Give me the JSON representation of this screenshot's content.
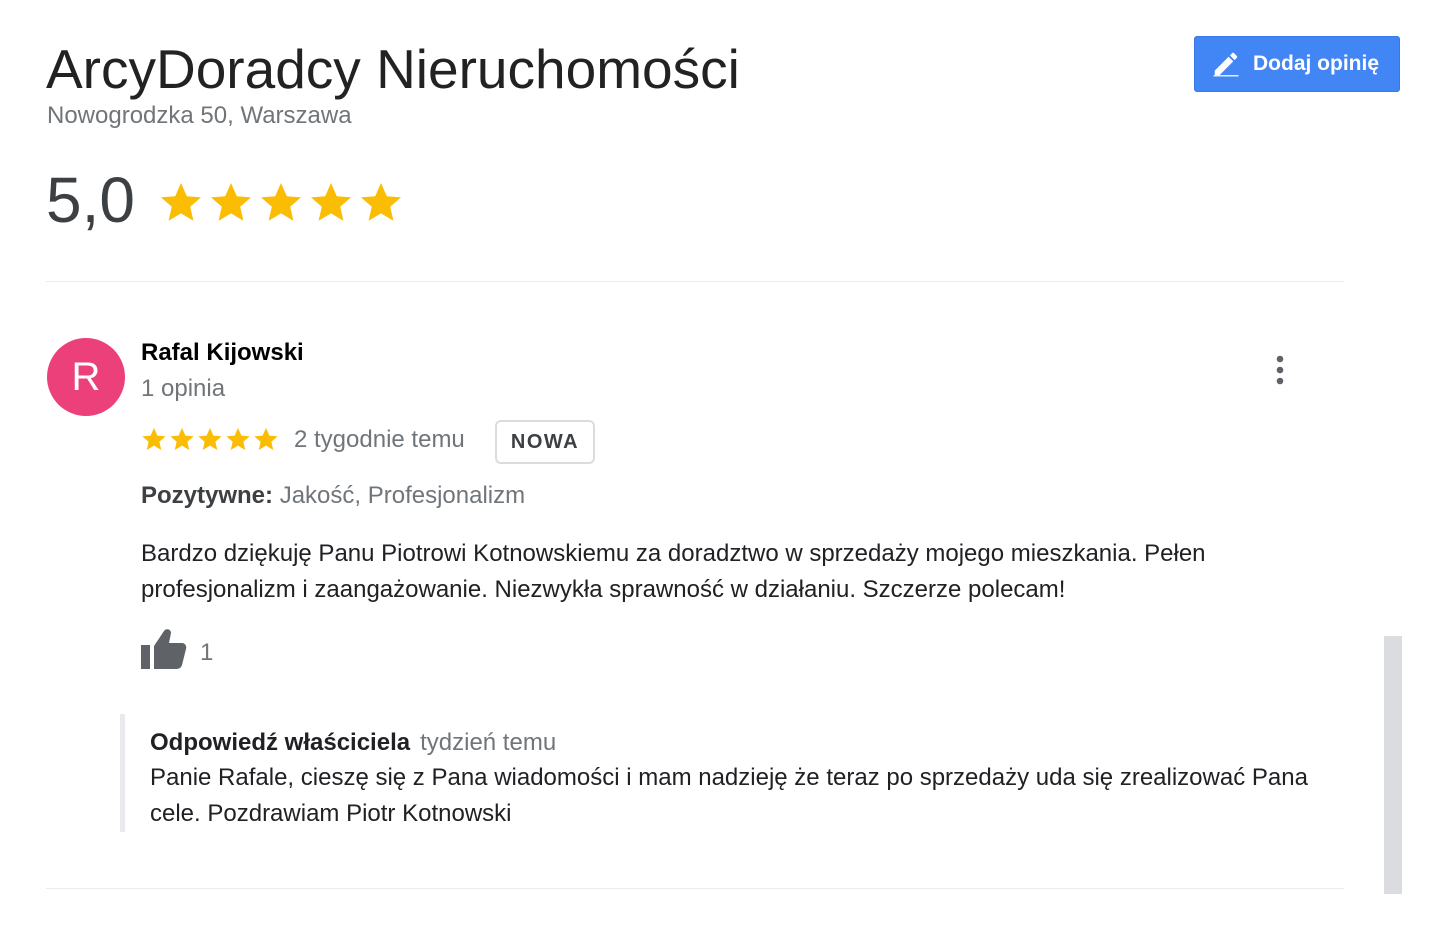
{
  "header": {
    "title": "ArcyDoradcy Nieruchomości",
    "address": "Nowogrodzka 50, Warszawa",
    "add_review_label": "Dodaj opinię"
  },
  "summary": {
    "rating_text": "5,0",
    "stars": 5,
    "star_color": "#fbbc04"
  },
  "review": {
    "avatar_letter": "R",
    "avatar_color": "#ec407a",
    "author": "Rafal Kijowski",
    "review_count": "1 opinia",
    "stars": 5,
    "time": "2 tygodnie temu",
    "badge": "NOWA",
    "positives_label": "Pozytywne:",
    "positives_value": "Jakość, Profesjonalizm",
    "text": "Bardzo dziękuję Panu Piotrowi Kotnowskiemu za doradztwo w sprzedaży mojego mieszkania. Pełen profesjonalizm i zaangażowanie. Niezwykła sprawność w działaniu.  Szczerze polecam!",
    "likes": "1",
    "owner_reply": {
      "label": "Odpowiedź właściciela",
      "time": "tydzień temu",
      "text": "Panie Rafale, cieszę się z Pana wiadomości i mam nadzieję że teraz po sprzedaży uda się zrealizować Pana cele. Pozdrawiam Piotr Kotnowski"
    }
  },
  "colors": {
    "button_blue": "#4285f4",
    "muted_text": "#70757a"
  }
}
